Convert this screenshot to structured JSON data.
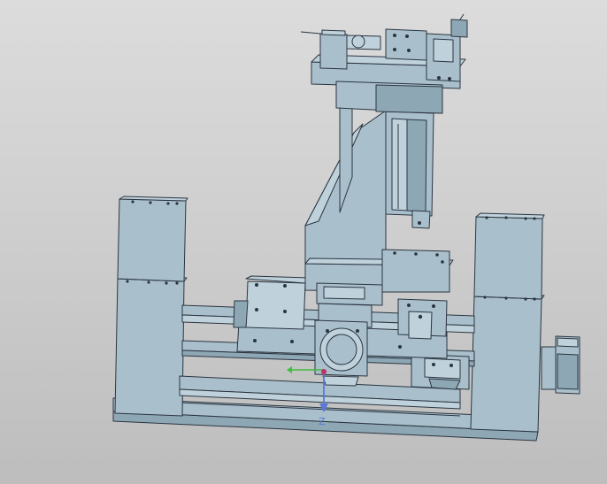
{
  "viewport": {
    "background": "#d2d2d2",
    "model_color": "#a9c0cc",
    "edge_color": "#2b3540"
  },
  "triad": {
    "z_label": "Z",
    "x_color": "#3fbf3f",
    "z_color": "#5a78d6",
    "origin_color": "#c0306a"
  }
}
